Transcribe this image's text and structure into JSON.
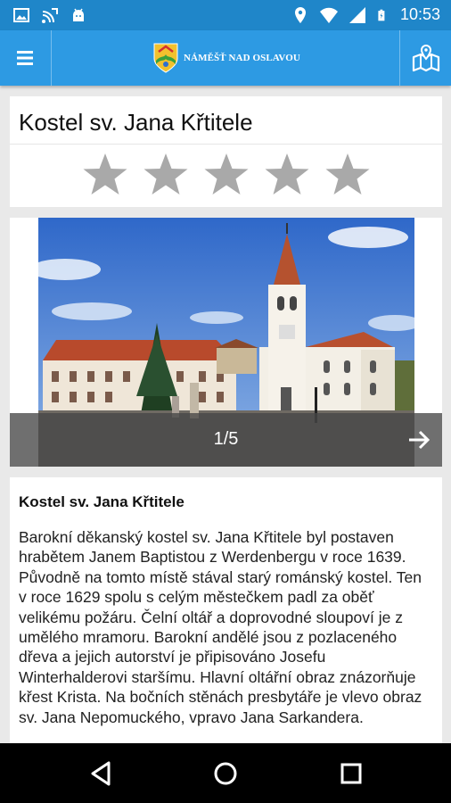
{
  "status_bar": {
    "time": "10:53",
    "left_icons": [
      "image-icon",
      "cast-icon",
      "android-icon"
    ],
    "right_icons": [
      "location-icon",
      "wifi-icon",
      "signal-icon",
      "battery-charging-icon"
    ]
  },
  "app_bar": {
    "title": "NÁMĚŠŤ NAD OSLAVOU",
    "menu_icon": "hamburger-icon",
    "map_icon": "map-pin-icon",
    "color": "#2d9ae3"
  },
  "poi": {
    "title": "Kostel sv. Jana Křtitele",
    "rating": 0,
    "rating_max": 5
  },
  "gallery": {
    "counter": "1/5",
    "next_icon": "arrow-right-icon"
  },
  "description": {
    "heading": "Kostel sv. Jana Křtitele",
    "body": "Barokní děkanský kostel sv. Jana Křtitele byl postaven hrabětem Janem Baptistou z Werdenbergu v roce 1639. Původně na tomto místě stával starý románský kostel. Ten v roce 1629 spolu s celým městečkem padl za oběť velikému požáru. Čelní oltář a doprovodné sloupoví je z umělého mramoru. Barokní andělé jsou z pozlaceného dřeva a jejich autorství je připisováno Josefu Winterhalderovi staršímu. Hlavní oltářní obraz znázorňuje křest Krista. Na bočních stěnách presbytáře je vlevo obraz sv. Jana Nepomuckého, vpravo Jana Sarkandera."
  },
  "nav_bar": {
    "icons": [
      "back-icon",
      "home-icon",
      "recents-icon"
    ]
  }
}
